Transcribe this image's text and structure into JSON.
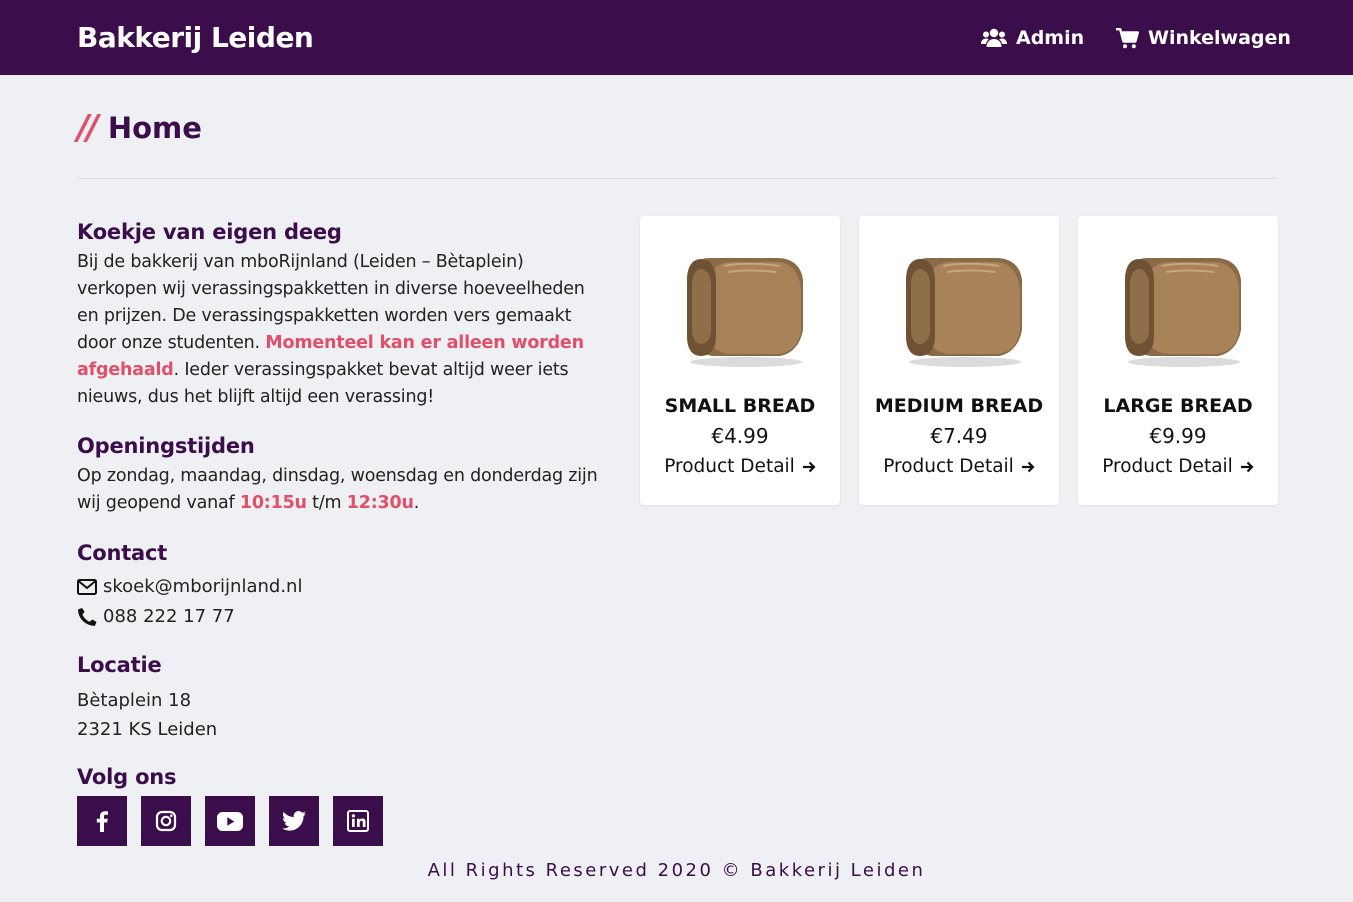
{
  "header": {
    "brand": "Bakkerij Leiden",
    "admin_label": "Admin",
    "cart_label": "Winkelwagen"
  },
  "page": {
    "slashes": "//",
    "title": "Home"
  },
  "about": {
    "heading": "Koekje van eigen deeg",
    "text_1": "Bij de bakkerij van mboRijnland (Leiden – Bètaplein) verkopen wij verassingspakketten in diverse hoeveelheden en prijzen. De verassingspakketten worden vers gemaakt door onze studenten. ",
    "highlight": "Momenteel kan er alleen worden afgehaald",
    "text_2": ". Ieder verassingspakket bevat altijd weer iets nieuws, dus het blijft altijd een verassing!"
  },
  "hours": {
    "heading": "Openingstijden",
    "text_1": "Op zondag, maandag, dinsdag, woensdag en donderdag zijn wij geopend vanaf ",
    "open": "10:15u",
    "text_2": " t/m ",
    "close": "12:30u",
    "text_3": "."
  },
  "contact": {
    "heading": "Contact",
    "email": "skoek@mborijnland.nl",
    "phone": "088 222 17 77"
  },
  "location": {
    "heading": "Locatie",
    "street": "Bètaplein 18",
    "city": "2321 KS Leiden"
  },
  "social": {
    "heading": "Volg ons",
    "icons": [
      "facebook-icon",
      "instagram-icon",
      "youtube-icon",
      "twitter-icon",
      "linkedin-icon"
    ]
  },
  "products": [
    {
      "name": "SMALL BREAD",
      "price": "€4.99",
      "link": "Product Detail"
    },
    {
      "name": "MEDIUM BREAD",
      "price": "€7.49",
      "link": "Product Detail"
    },
    {
      "name": "LARGE BREAD",
      "price": "€9.99",
      "link": "Product Detail"
    }
  ],
  "footer": {
    "text": "All Rights Reserved 2020 © Bakkerij Leiden"
  },
  "colors": {
    "primary": "#3b0d4a",
    "accent": "#e0506b",
    "background": "#eff0f3"
  }
}
